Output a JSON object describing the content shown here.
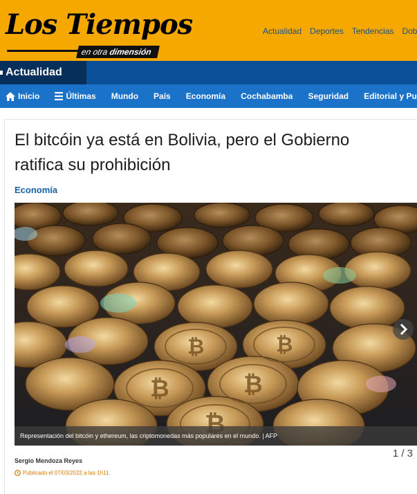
{
  "header": {
    "logo_text": "Los Tiempos",
    "logo_tagline_prefix": "en otra ",
    "logo_tagline_bold": "dimensión",
    "top_nav": [
      "Actualidad",
      "Deportes",
      "Tendencias",
      "Doble"
    ]
  },
  "section": {
    "label": "Actualidad"
  },
  "main_nav": {
    "home_label": "Inicio",
    "latest_label": "Últimas",
    "items": [
      "Mundo",
      "País",
      "Economía",
      "Cochabamba",
      "Seguridad",
      "Editorial y Puntos de"
    ]
  },
  "article": {
    "headline": "El bitcóin ya está en Bolivia, pero el Gobierno ratifica su prohibición",
    "category": "Economía",
    "photo_caption": "Representación del bitcóin y ethereum, las criptomonedas más populares en el mundo. | AFP",
    "photo_counter": "1 / 3",
    "author": "Sergio Mendoza Reyes",
    "published": "Publicado el 07/03/2022 a las 1h11"
  },
  "colors": {
    "header_bg": "#f5a800",
    "section_bar": "#0a4f97",
    "nav_bar": "#1a72c9",
    "category": "#1a62a8",
    "published": "#e07b00"
  },
  "icons": [
    "home-icon",
    "list-icon",
    "chevron-right-icon",
    "clock-icon"
  ]
}
